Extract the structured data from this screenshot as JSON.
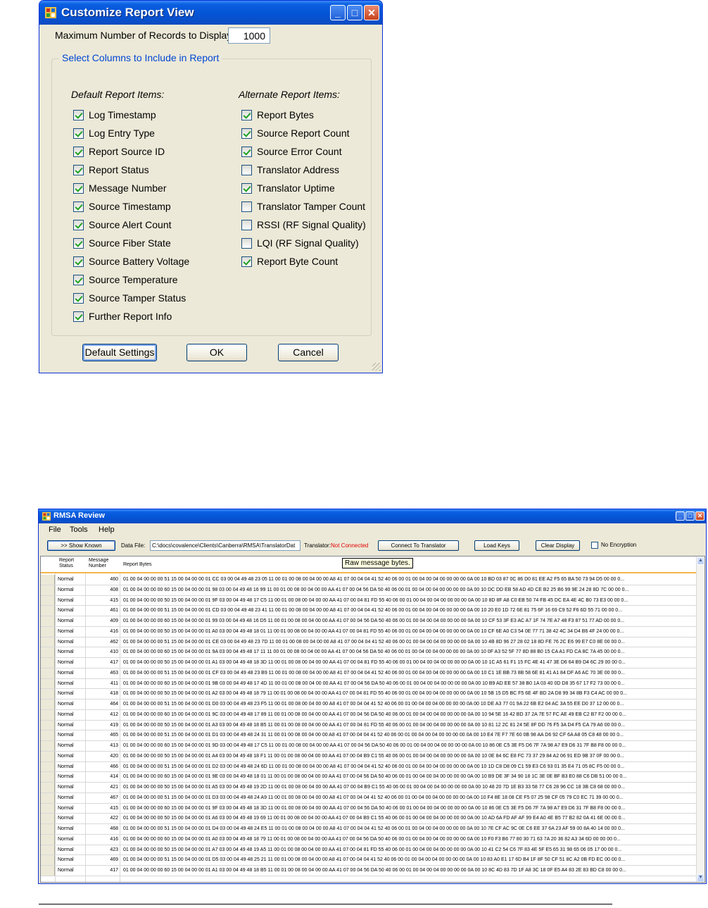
{
  "dialog": {
    "title": "Customize Report View",
    "max_records_label": "Maximum Number of Records to Display:",
    "max_records_value": "1000",
    "group_title": "Select Columns to Include in Report",
    "default_header": "Default Report Items:",
    "alternate_header": "Alternate Report Items:",
    "default_items": [
      {
        "label": "Log Timestamp",
        "checked": true
      },
      {
        "label": "Log Entry Type",
        "checked": true
      },
      {
        "label": "Report Source ID",
        "checked": true
      },
      {
        "label": "Report Status",
        "checked": true
      },
      {
        "label": "Message Number",
        "checked": true
      },
      {
        "label": "Source Timestamp",
        "checked": true
      },
      {
        "label": "Source Alert Count",
        "checked": true
      },
      {
        "label": "Source Fiber State",
        "checked": true
      },
      {
        "label": "Source Battery Voltage",
        "checked": true
      },
      {
        "label": "Source Temperature",
        "checked": true
      },
      {
        "label": "Source Tamper Status",
        "checked": true
      },
      {
        "label": "Further Report Info",
        "checked": true
      }
    ],
    "alternate_items": [
      {
        "label": "Report Bytes",
        "checked": true
      },
      {
        "label": "Source Report Count",
        "checked": true
      },
      {
        "label": "Source Error Count",
        "checked": true
      },
      {
        "label": "Translator Address",
        "checked": false
      },
      {
        "label": "Translator Uptime",
        "checked": true
      },
      {
        "label": "Translator Tamper Count",
        "checked": false
      },
      {
        "label": "RSSI (RF Signal Quality)",
        "checked": false
      },
      {
        "label": "LQI (RF Signal Quality)",
        "checked": false
      },
      {
        "label": "Report Byte Count",
        "checked": true
      }
    ],
    "buttons": {
      "defaults": "Default Settings",
      "ok": "OK",
      "cancel": "Cancel"
    }
  },
  "rmsa": {
    "title": "RMSA Review",
    "menu": {
      "file": "File",
      "tools": "Tools",
      "help": "Help"
    },
    "toolbar": {
      "show_known": ">> Show Known",
      "data_file_label": "Data File:",
      "data_file_path": "C:\\docs\\covalence\\Clients\\Canberra\\RMSA\\TranslatorDat",
      "translator_label": "Translator:",
      "translator_status": "Not Connected",
      "connect": "Connect To Translator",
      "load_keys": "Load Keys",
      "clear_display": "Clear Display",
      "no_encryption": "No Encryption"
    },
    "columns": {
      "status": "Report Status",
      "number": "Message Number",
      "bytes": "Report Bytes"
    },
    "tooltip": "Raw message bytes.",
    "rows": [
      {
        "status": "Normal",
        "number": "460",
        "bytes": "01 00 04 00 00 00 51 15 00 04 00 00 01 CC 03 00 04 49 48 23 05 11 00 01 00 08 00 04 00 00 A8 41 07 00 04 04 41 52 40 06 00 01 00 04 00 04 00 00 00 00 0A 00 10 BD 03 87 0C 86 D0 81 EE A2 F5 65 BA 50 73 94 D5 00 00 0..."
      },
      {
        "status": "Normal",
        "number": "408",
        "bytes": "01 00 04 00 00 00 60 15 00 04 00 00 01 98 03 00 04 49 48 16 99 11 00 01 00 08 00 04 00 00 AA 41 07 00 04 56 DA 50 40 06 00 01 00 04 00 04 00 00 00 00 0A 00 10 DC DD EB 58 AD 4D CE B2 25 B6 99 9E 24 28 8D 7C 00 00 0..."
      },
      {
        "status": "Normal",
        "number": "415",
        "bytes": "01 00 04 00 00 00 50 15 00 04 00 00 01 9F 03 00 04 49 48 17 C5 11 00 01 00 08 00 04 00 00 AA 41 07 00 04 81 FD 55 40 06 00 01 00 04 00 04 00 00 00 00 0A 00 10 8D 8F A8 C0 EB 50 74 FB 45 DC EA 4E 4C B0 73 E3 00 00 0..."
      },
      {
        "status": "Normal",
        "number": "461",
        "bytes": "01 00 04 00 00 00 51 15 00 04 00 00 01 CD 03 00 04 49 48 23 41 11 00 01 00 08 00 04 00 00 A8 41 07 00 04 04 41 52 40 06 00 01 00 04 00 04 00 00 00 00 0A 00 10 20 E0 1D 72 6E 81 75 6F 16 69 C9 52 F6 6D 55 71 00 00 0..."
      },
      {
        "status": "Normal",
        "number": "409",
        "bytes": "01 00 04 00 00 00 60 15 00 04 00 00 01 99 03 00 04 49 48 16 D5 11 00 01 00 08 00 04 00 00 AA 41 07 00 04 56 DA 50 40 06 00 01 00 04 00 04 00 00 00 00 0A 00 10 CF 53 3F E3 AC A7 1F 74 7E A7 48 F3 87 51 77 AD 00 00 0..."
      },
      {
        "status": "Normal",
        "number": "416",
        "bytes": "01 00 04 00 00 00 50 15 00 04 00 00 01 A0 03 00 04 49 48 18 01 11 00 01 00 08 00 04 00 00 AA 41 07 00 04 81 FD 55 40 06 00 01 00 04 00 04 00 00 00 00 0A 00 10 CF 6E A0 C3 54 0E 77 71 38 42 4C 34 D4 B6 4F 24 00 00 0..."
      },
      {
        "status": "Normal",
        "number": "462",
        "bytes": "01 00 04 00 00 00 51 15 00 04 00 00 01 CE 03 00 04 49 48 23 7D 11 00 01 00 08 00 04 00 00 A8 41 07 00 04 04 41 52 40 06 00 01 00 04 00 04 00 00 00 00 0A 00 10 4B 8D 96 27 28 02 18 8D FE 76 2C E6 99 E7 C0 8E 00 00 0..."
      },
      {
        "status": "Normal",
        "number": "410",
        "bytes": "01 00 04 00 00 00 60 15 00 04 00 00 01 9A 03 00 04 49 48 17 11 11 00 01 00 08 00 04 00 00 AA 41 07 00 04 56 DA 50 40 06 00 01 00 04 00 04 00 00 00 00 0A 00 10 0F A3 52 5F 77 8D 88 B0 15 CA A1 FD CA 8C 7A 45 00 00 0..."
      },
      {
        "status": "Normal",
        "number": "417",
        "bytes": "01 00 04 00 00 00 50 15 00 04 00 00 01 A1 03 00 04 49 48 18 3D 11 00 01 00 08 00 04 00 00 AA 41 07 00 04 81 FD 55 40 06 00 01 00 04 00 04 00 00 00 00 0A 00 10 1C A5 61 F1 15 FC 4E 41 47 3E D6 64 B9 D4 6C 29 00 00 0..."
      },
      {
        "status": "Normal",
        "number": "463",
        "bytes": "01 00 04 00 00 00 51 15 00 04 00 00 01 CF 03 00 04 49 48 23 B9 11 00 01 00 08 00 04 00 00 A8 41 07 00 04 04 41 52 40 06 00 01 00 04 00 04 00 00 00 00 0A 00 10 C1 1E BB 73 8B 58 6E 81 41 A1 84 DF A6 AC 70 3E 00 00 0..."
      },
      {
        "status": "Normal",
        "number": "411",
        "bytes": "01 00 04 00 00 00 60 15 00 04 00 00 01 9B 03 00 04 49 48 17 4D 11 00 01 00 08 00 04 00 00 AA 41 07 00 04 56 DA 50 40 06 00 01 00 04 00 04 00 00 00 00 0A 00 10 B9 AD EE 57 38 B0 1A 03 40 0D D8 35 67 17 F2 73 00 00 0..."
      },
      {
        "status": "Normal",
        "number": "418",
        "bytes": "01 00 04 00 00 00 50 15 00 04 00 00 01 A2 03 00 04 49 48 18 79 11 00 01 00 08 00 04 00 00 AA 41 07 00 04 81 FD 55 40 06 00 01 00 04 00 04 00 00 00 00 0A 00 10 5B 15 D5 BC F5 6E 4F BD 2A D8 99 34 8B F3 C4 AC 00 00 0..."
      },
      {
        "status": "Normal",
        "number": "464",
        "bytes": "01 00 04 00 00 00 51 15 00 04 00 00 01 D0 03 00 04 49 48 23 F5 11 00 01 00 08 00 04 00 00 A8 41 07 00 04 04 41 52 40 06 00 01 00 04 00 04 00 00 00 00 0A 00 10 DE A3 77 01 9A 22 6B E2 04 AC 3A 55 EE D0 37 12 00 00 0..."
      },
      {
        "status": "Normal",
        "number": "412",
        "bytes": "01 00 04 00 00 00 60 15 00 04 00 00 01 9C 03 00 04 49 48 17 89 11 00 01 00 08 00 04 00 00 AA 41 07 00 04 56 DA 50 40 06 00 01 00 04 00 04 00 00 00 00 0A 00 10 94 5E 16 42 BD 37 2A 7E 57 FC AE 49 EB C2 B7 F2 00 00 0..."
      },
      {
        "status": "Normal",
        "number": "419",
        "bytes": "01 00 04 00 00 00 50 15 00 04 00 00 01 A3 03 00 04 49 48 18 B5 11 00 01 00 08 00 04 00 00 AA 41 07 00 04 81 FD 55 40 06 00 01 00 04 00 04 00 00 00 00 0A 00 10 81 12 2C 81 24 5E 8F DD 76 F5 3A D4 F5 CA 79 A6 00 00 0..."
      },
      {
        "status": "Normal",
        "number": "465",
        "bytes": "01 00 04 00 00 00 51 15 00 04 00 00 01 D1 03 00 04 49 48 24 31 11 00 01 00 08 00 04 00 00 A8 41 07 00 04 04 41 52 40 06 00 01 00 04 00 04 00 00 00 00 0A 00 10 E4 7E F7 7E 60 0B 98 AA D6 92 CF 6A A8 05 C8 48 00 00 0..."
      },
      {
        "status": "Normal",
        "number": "413",
        "bytes": "01 00 04 00 00 00 60 15 00 04 00 00 01 9D 03 00 04 49 48 17 C5 11 00 01 00 08 00 04 00 00 AA 41 07 00 04 56 DA 50 40 06 00 01 00 04 00 04 00 00 00 00 0A 00 10 86 0E C5 3E F5 D6 7F 7A 98 A7 E9 D6 31 7F B8 F8 00 00 0..."
      },
      {
        "status": "Normal",
        "number": "420",
        "bytes": "01 00 04 00 00 00 50 15 00 04 00 00 01 A4 03 00 04 49 48 18 F1 11 00 01 00 08 00 04 00 00 AA 41 07 00 04 B9 C1 55 40 06 00 01 00 04 00 04 00 00 00 00 0A 00 10 0E 84 6C E8 FC 73 37 29 84 A2 06 91 ED 9B 37 0F 00 00 0..."
      },
      {
        "status": "Normal",
        "number": "466",
        "bytes": "01 00 04 00 00 00 51 15 00 04 00 00 01 D2 03 00 04 49 48 24 6D 11 00 01 00 08 00 04 00 00 A8 41 07 00 04 04 41 52 40 06 00 01 00 04 00 04 00 00 00 00 0A 00 10 1D C8 D8 09 C1 59 E3 C6 93 01 35 E4 71 05 8C F5 00 00 0..."
      },
      {
        "status": "Normal",
        "number": "414",
        "bytes": "01 00 04 00 00 00 60 15 00 04 00 00 01 9E 03 00 04 49 48 18 01 11 00 01 00 08 00 04 00 00 AA 41 07 00 04 56 DA 50 40 06 00 01 00 04 00 04 00 00 00 00 0A 00 10 B9 DE 3F 34 90 18 1C 3E 0E BF B3 E0 88 C6 DB 51 00 00 0..."
      },
      {
        "status": "Normal",
        "number": "421",
        "bytes": "01 00 04 00 00 00 50 15 00 04 00 00 01 A5 03 00 04 49 48 19 2D 11 00 01 00 08 00 04 00 00 AA 41 07 00 04 B9 C1 55 40 06 00 01 00 04 00 04 00 00 00 00 0A 00 10 48 20 7D 1E B3 33 58 77 C6 28 96 CC 18 3B C8 68 00 00 0..."
      },
      {
        "status": "Normal",
        "number": "467",
        "bytes": "01 00 04 00 00 00 51 15 00 04 00 00 01 D3 03 00 04 49 48 24 A9 11 00 01 00 08 00 04 00 00 A8 41 07 00 04 04 41 52 40 06 00 01 00 04 00 04 00 00 00 00 0A 00 10 F4 8E 18 08 CE F5 07 25 98 CF 05 79 C0 EC 71 39 00 00 0..."
      },
      {
        "status": "Normal",
        "number": "415",
        "bytes": "01 00 04 00 00 00 60 15 00 04 00 00 01 9F 03 00 04 49 48 18 3D 11 00 01 00 08 00 04 00 00 AA 41 07 00 04 56 DA 50 40 06 00 01 00 04 00 04 00 00 00 00 0A 00 10 86 0E C5 3E F5 D6 7F 7A 98 A7 E9 D6 31 7F B8 F8 00 00 0..."
      },
      {
        "status": "Normal",
        "number": "422",
        "bytes": "01 00 04 00 00 00 50 15 00 04 00 00 01 A6 03 00 04 49 48 19 69 11 00 01 00 08 00 04 00 00 AA 41 07 00 04 B9 C1 55 40 06 00 01 00 04 00 04 00 00 00 00 0A 00 10 AD 6A FD AF AF 99 E4 A0 4E B5 77 B2 82 0A 41 6E 00 00 0..."
      },
      {
        "status": "Normal",
        "number": "468",
        "bytes": "01 00 04 00 00 00 51 15 00 04 00 00 01 D4 03 00 04 49 48 24 E5 11 00 01 00 08 00 04 00 00 A8 41 07 00 04 04 41 52 40 06 00 01 00 04 00 04 00 00 00 00 0A 00 10 7E CF AC 9C 0E C6 EE 37 6A 23 AF 59 00 8A 40 14 00 00 0..."
      },
      {
        "status": "Normal",
        "number": "416",
        "bytes": "01 00 04 00 00 00 60 15 00 04 00 00 01 A0 03 00 04 49 48 18 79 11 00 01 00 08 00 04 00 00 AA 41 07 00 04 56 DA 50 40 06 00 01 00 04 00 04 00 00 00 00 0A 00 10 F0 F3 B6 77 80 30 71 63 7A 20 36 82 A3 34 6D 00 00 00 0..."
      },
      {
        "status": "Normal",
        "number": "423",
        "bytes": "01 00 04 00 00 00 50 15 00 04 00 00 01 A7 03 00 04 49 48 19 A5 11 00 01 00 08 00 04 00 00 AA 41 07 00 04 81 FD 55 40 06 00 01 00 04 00 04 00 00 00 00 0A 00 10 41 C2 54 C6 7F 83 4E 5F E5 65 31 98 65 06 05 17 00 00 0..."
      },
      {
        "status": "Normal",
        "number": "469",
        "bytes": "01 00 04 00 00 00 51 15 00 04 00 00 01 D5 03 00 04 49 48 25 21 11 00 01 00 08 00 04 00 00 A8 41 07 00 04 04 41 52 40 06 00 01 00 04 00 04 00 00 00 00 0A 00 10 83 A0 E1 17 6D B4 1F 8F 50 CF 51 8C A2 0B FD EC 00 00 0..."
      },
      {
        "status": "Normal",
        "number": "417",
        "bytes": "01 00 04 00 00 00 60 15 00 04 00 00 01 A1 03 00 04 49 48 18 B5 11 00 01 00 08 00 04 00 00 AA 41 07 00 04 56 DA 50 40 06 00 01 00 04 00 04 00 00 00 00 0A 00 10 8C 4D 83 7D 1F A8 3C 18 0F E5 A4 83 2E 83 BD C8 00 00 0..."
      }
    ]
  },
  "colors": {
    "title_blue": "#0054e3",
    "not_connected": "#e00000",
    "group_title": "#0046d5"
  },
  "icons": [
    "app-icon",
    "minimize-icon",
    "maximize-icon",
    "close-icon",
    "checkmark-icon",
    "scroll-up-icon",
    "scroll-down-icon",
    "resize-grip-icon"
  ]
}
